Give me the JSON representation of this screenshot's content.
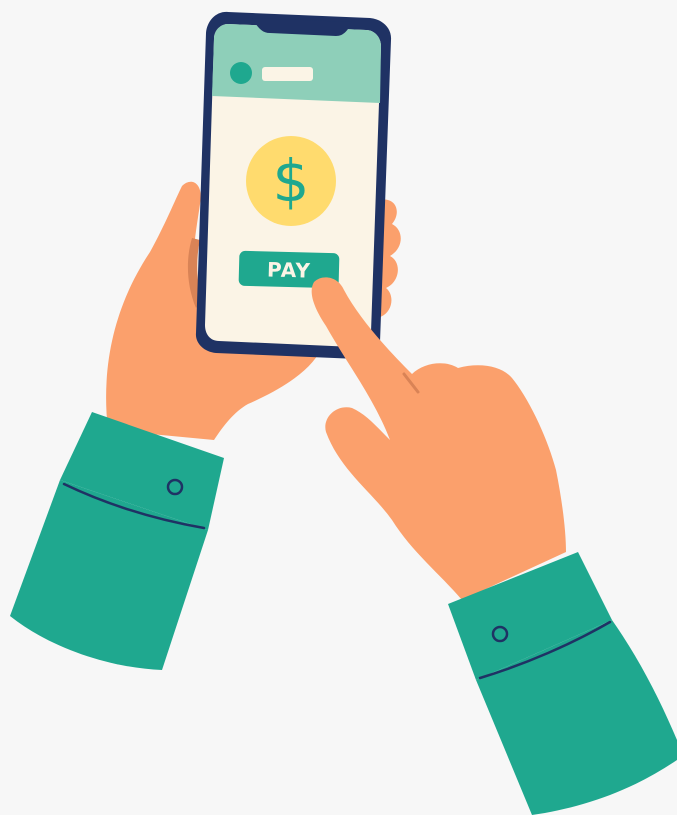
{
  "screen": {
    "pay_button_label": "PAY",
    "currency_symbol": "$"
  },
  "icons": {
    "avatar": "avatar-dot",
    "coin": "dollar-coin-icon",
    "cuff_button": "button-icon"
  },
  "colors": {
    "background": "#f7f7f7",
    "phone_frame": "#1f3264",
    "screen_bg": "#fbf4e6",
    "screen_header": "#8ecfb9",
    "header_dot": "#1fa88f",
    "coin": "#ffdb6e",
    "coin_symbol": "#1fa88f",
    "pay_button": "#1fa88f",
    "pay_text": "#fbf4e6",
    "skin": "#fba06c",
    "skin_shadow": "#d98356",
    "sleeve": "#1fa88f",
    "sleeve_line": "#1f3264"
  }
}
